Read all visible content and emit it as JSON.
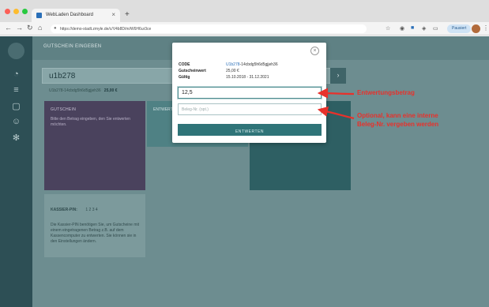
{
  "colors": {
    "annotation": "#e8312b",
    "accent": "#2f7478",
    "sidebar": "#2d4f55",
    "overlay": "#6d8d90"
  },
  "browser": {
    "tab_title": "WebLaden Dashboard",
    "new_tab_label": "+",
    "url": "https://demo-stadt.zmyle.de/c/V4b8D/m/W6H6ur3ce",
    "paused_label": "Pausiert"
  },
  "app": {
    "header_title": "GUTSCHEIN EINGEBEN",
    "code_input_value": "u1b278",
    "code_info_text": "U1b278-14cbdg5h6d5gjjeh36",
    "code_info_amount": "25,00 €",
    "card_purple": {
      "title": "GUTSCHEIN",
      "text": "Bitte den Betrag eingeben, den Sie entwerten möchten."
    },
    "card_teal_text": "ENTWERTEN",
    "pin_label": "KASSIER-PIN:",
    "pin_value": "1 2 3 4",
    "pin_text": "Die Kassier-PIN benötigen Sie, um Gutscheine mit einem eingetragenen Betrag z.B. auf dem Kassencomputer zu entwerten. Sie können sie in den Einstellungen ändern."
  },
  "modal": {
    "close_icon_label": "×",
    "rows": [
      {
        "label": "CODE",
        "value": "U1b278-14cbdg5h6d5gjjeh36"
      },
      {
        "label": "Gutscheinwert",
        "value": "25,00 €"
      },
      {
        "label": "Gültig",
        "value": "15.10.2018 - 31.12.2021"
      }
    ],
    "code_highlight": "U1b278",
    "code_suffix": "-14cbdg5h6d5gjjeh36",
    "amount_value": "12,5",
    "receipt_placeholder": "Beleg-Nr. (opt.)",
    "submit_label": "ENTWERTEN"
  },
  "annotations": {
    "amount": "Entwertungsbetrag",
    "receipt_line1": "Optional, kann eine interne",
    "receipt_line2": "Beleg-Nr. vergeben werden"
  }
}
